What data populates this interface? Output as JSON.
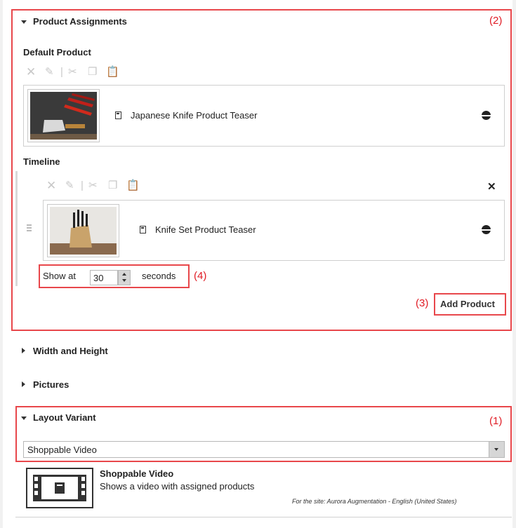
{
  "product_assignments": {
    "header": "Product Assignments",
    "annotation": "(2)",
    "default_product": {
      "label": "Default Product",
      "item_title": "Japanese Knife Product Teaser"
    },
    "timeline": {
      "label": "Timeline",
      "item_title": "Knife Set Product Teaser",
      "show_at_label": "Show at",
      "show_at_value": "30",
      "seconds_label": "seconds",
      "annotation": "(4)"
    },
    "add_product_label": "Add Product",
    "add_product_annotation": "(3)"
  },
  "collapsed_sections": {
    "width_height": "Width and Height",
    "pictures": "Pictures"
  },
  "layout_variant": {
    "header": "Layout Variant",
    "annotation": "(1)",
    "selected": "Shoppable Video",
    "option_title": "Shoppable Video",
    "option_description": "Shows a video with assigned products",
    "site_note": "For the site: Aurora Augmentation - English (United States)"
  },
  "colors": {
    "highlight": "#e8474b",
    "annotation_text": "#e01b24"
  },
  "icons": [
    "triangle-down-icon",
    "triangle-right-icon",
    "delete-icon",
    "edit-icon",
    "cut-icon",
    "copy-icon",
    "paste-icon",
    "document-icon",
    "globe-icon",
    "drag-handle-icon",
    "close-icon",
    "spinner-up-icon",
    "spinner-down-icon",
    "dropdown-arrow-icon",
    "video-layout-icon"
  ]
}
